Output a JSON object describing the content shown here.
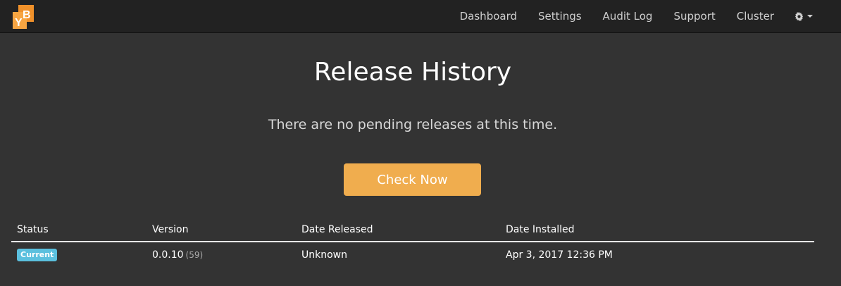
{
  "navbar": {
    "logo_letters": "YB",
    "links": [
      "Dashboard",
      "Settings",
      "Audit Log",
      "Support",
      "Cluster"
    ],
    "settings_icon": "gear-icon",
    "brand_colors": {
      "logo_orange": "#f0912a",
      "background": "#222222"
    }
  },
  "main": {
    "title": "Release History",
    "subtitle": "There are no pending releases at this time.",
    "check_button_label": "Check Now",
    "button_color": "#f0ad4e"
  },
  "table": {
    "headers": [
      "Status",
      "Version",
      "Date Released",
      "Date Installed"
    ],
    "rows": [
      {
        "status": "Current",
        "version": "0.0.10",
        "build": "(59)",
        "date_released": "Unknown",
        "date_installed": "Apr 3, 2017 12:36 PM"
      }
    ],
    "status_badge_color": "#5bc0de"
  }
}
